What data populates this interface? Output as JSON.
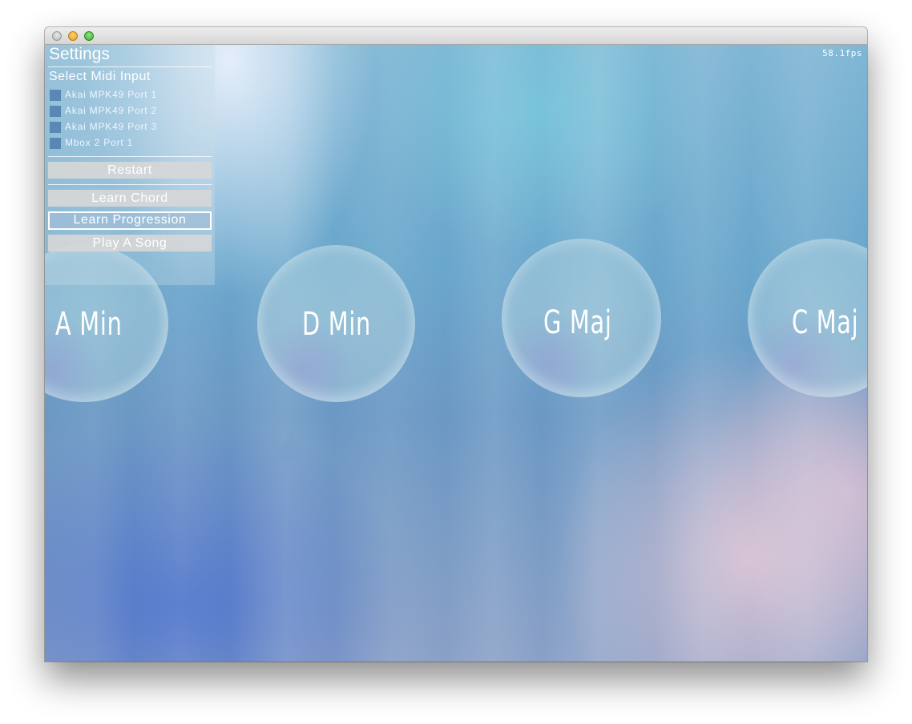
{
  "fps_readout": "58.1fps",
  "settings": {
    "title": "Settings",
    "midi_section_title": "Select Midi Input",
    "midi_inputs": [
      {
        "label": "Akai MPK49 Port 1",
        "checked": false
      },
      {
        "label": "Akai MPK49 Port 2",
        "checked": false
      },
      {
        "label": "Akai MPK49 Port 3",
        "checked": false
      },
      {
        "label": "Mbox 2 Port 1",
        "checked": false
      }
    ],
    "restart_label": "Restart",
    "learn_chord_label": "Learn Chord",
    "learn_progression_label": "Learn Progression",
    "play_song_label": "Play A Song",
    "active_mode": "Learn Progression"
  },
  "chords": [
    {
      "label": "A Min"
    },
    {
      "label": "D Min"
    },
    {
      "label": "G Maj"
    },
    {
      "label": "C Maj"
    }
  ],
  "colors": {
    "panel_bg": "rgba(200,220,232,0.35)",
    "button_bg": "#d7d7d7",
    "text": "#ffffff"
  }
}
